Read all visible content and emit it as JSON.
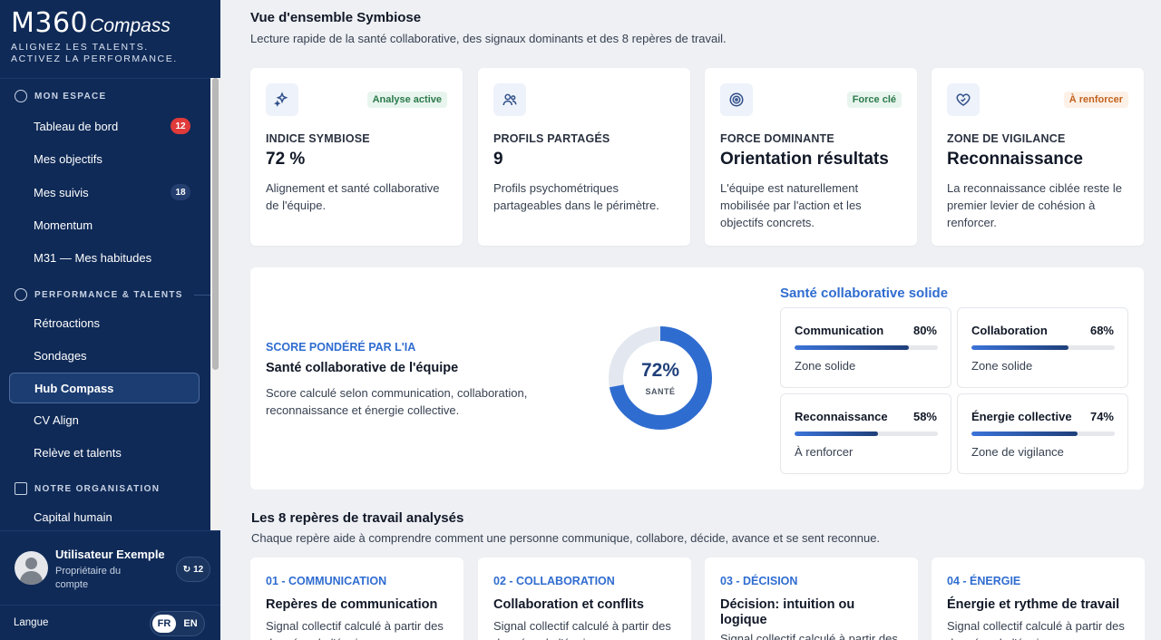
{
  "brand": {
    "name": "M360",
    "product": "Compass",
    "tagline_1": "ALIGNEZ LES TALENTS.",
    "tagline_2": "ACTIVEZ LA PERFORMANCE."
  },
  "sidebar": {
    "sections": [
      {
        "title": "MON ESPACE"
      },
      {
        "title": "PERFORMANCE & TALENTS"
      },
      {
        "title": "NOTRE ORGANISATION"
      }
    ],
    "items": [
      {
        "label": "Tableau de bord",
        "badge": "12"
      },
      {
        "label": "Mes objectifs"
      },
      {
        "label": "Mes suivis",
        "badge": "18"
      },
      {
        "label": "Momentum"
      },
      {
        "label": "M31 — Mes habitudes"
      },
      {
        "label": "Rétroactions"
      },
      {
        "label": "Sondages"
      },
      {
        "label": "Hub Compass"
      },
      {
        "label": "CV Align"
      },
      {
        "label": "Relève et talents"
      },
      {
        "label": "Capital humain"
      }
    ],
    "user": {
      "name": "Utilisateur Exemple",
      "role": "Propriétaire du compte",
      "energy": "12"
    },
    "language": {
      "label": "Langue",
      "fr": "FR",
      "en": "EN",
      "selected": "FR"
    }
  },
  "overview": {
    "title": "Vue d'ensemble Symbiose",
    "subtitle": "Lecture rapide de la santé collaborative, des signaux dominants et des 8 repères de travail.",
    "kpis": [
      {
        "label": "INDICE SYMBIOSE",
        "value": "72 %",
        "desc": "Alignement et santé collaborative de l'équipe.",
        "tag": "Analyse active",
        "icon": "sparkles-icon"
      },
      {
        "label": "PROFILS PARTAGÉS",
        "value": "9",
        "desc": "Profils psychométriques partageables dans le périmètre.",
        "tag": "",
        "icon": "users-icon"
      },
      {
        "label": "FORCE DOMINANTE",
        "value": "Orientation résultats",
        "desc": "L'équipe est naturellement mobilisée par l'action et les objectifs concrets.",
        "tag": "Force clé",
        "icon": "target-icon"
      },
      {
        "label": "ZONE DE VIGILANCE",
        "value": "Reconnaissance",
        "desc": "La reconnaissance ciblée reste le premier levier de cohésion à renforcer.",
        "tag": "À renforcer",
        "icon": "heart-handshake-icon"
      }
    ]
  },
  "health": {
    "kicker": "SCORE PONDÉRÉ PAR L'IA",
    "title": "Santé collaborative de l'équipe",
    "desc": "Score calculé selon communication, collaboration, reconnaissance et énergie collective.",
    "score": 72,
    "score_label": "72%",
    "score_caption": "SANTÉ",
    "heading": "Santé collaborative solide",
    "metrics": [
      {
        "name": "Communication",
        "pct": "80%",
        "value": 80,
        "status": "Zone solide"
      },
      {
        "name": "Collaboration",
        "pct": "68%",
        "value": 68,
        "status": "Zone solide"
      },
      {
        "name": "Reconnaissance",
        "pct": "58%",
        "value": 58,
        "status": "À renforcer"
      },
      {
        "name": "Énergie collective",
        "pct": "74%",
        "value": 74,
        "status": "Zone de vigilance"
      }
    ],
    "colors": {
      "accent": "#2f6cd0",
      "dark": "#1f3f7a",
      "track": "#e3e8f0"
    }
  },
  "reperes": {
    "title": "Les 8 repères de travail analysés",
    "subtitle": "Chaque repère aide à comprendre comment une personne communique, collabore, décide, avance et se sent reconnue.",
    "cards": [
      {
        "kicker": "01 - COMMUNICATION",
        "title": "Repères de communication",
        "desc": "Signal collectif calculé à partir des données de l'équipe."
      },
      {
        "kicker": "02 - COLLABORATION",
        "title": "Collaboration et conflits",
        "desc": "Signal collectif calculé à partir des données de l'équipe."
      },
      {
        "kicker": "03 - DÉCISION",
        "title": "Décision: intuition ou logique",
        "desc": "Signal collectif calculé à partir des données de l'équipe."
      },
      {
        "kicker": "04 - ÉNERGIE",
        "title": "Énergie et rythme de travail",
        "desc": "Signal collectif calculé à partir des données de l'équipe."
      }
    ]
  }
}
